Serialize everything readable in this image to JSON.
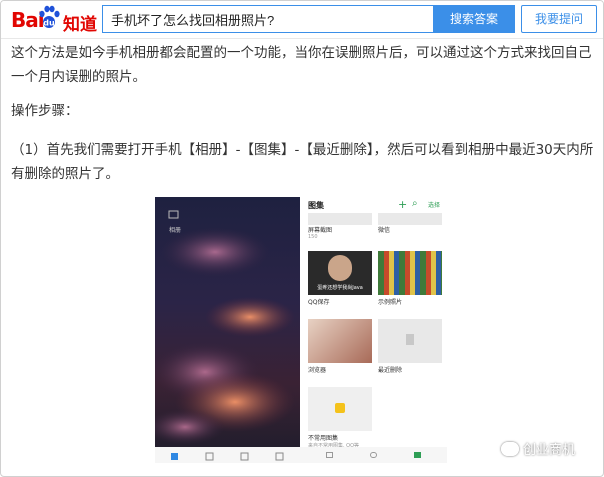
{
  "header": {
    "logo_bai": "Bai",
    "logo_zhidao": "知道",
    "search_value": "手机坏了怎么找回相册照片?",
    "search_button": "搜索答案",
    "ask_button": "我要提问"
  },
  "article": {
    "paragraph1": "这个方法是如今手机相册都会配置的一个功能，当你在误删照片后，可以通过这个方式来找回自己一个月内误删的照片。",
    "paragraph2": "操作步骤：",
    "paragraph3": "（1）首先我们需要打开手机【相册】-【图集】-【最近删除】，然后可以看到相册中最近30天内所有删除的照片了。"
  },
  "phone_screenshot": {
    "left_label": "相册",
    "title": "图集",
    "add_glyph": "+",
    "search_glyph": "⌕",
    "select_label": "选择",
    "albums": [
      {
        "name": "屏幕截图",
        "count": "150",
        "thumb": "#e9e9e9"
      },
      {
        "name": "微信",
        "count": "",
        "thumb": "#e9e9e9"
      },
      {
        "name": "QQ保存",
        "count": "",
        "thumb": "#2a2a2a",
        "caption": "蛋疼还想学我尚Java"
      },
      {
        "name": "示例照片",
        "count": "",
        "thumb": "#3f7a3a"
      },
      {
        "name": "浏览器",
        "count": "",
        "thumb": "#c99a86"
      },
      {
        "name": "最近删除",
        "count": "",
        "thumb": "#e8e8e8"
      },
      {
        "name": "不常用图集",
        "count": "",
        "thumb": "#efefef"
      }
    ],
    "bottom_note": "来自不常用图集, QQ等"
  },
  "watermark": "创业商机"
}
